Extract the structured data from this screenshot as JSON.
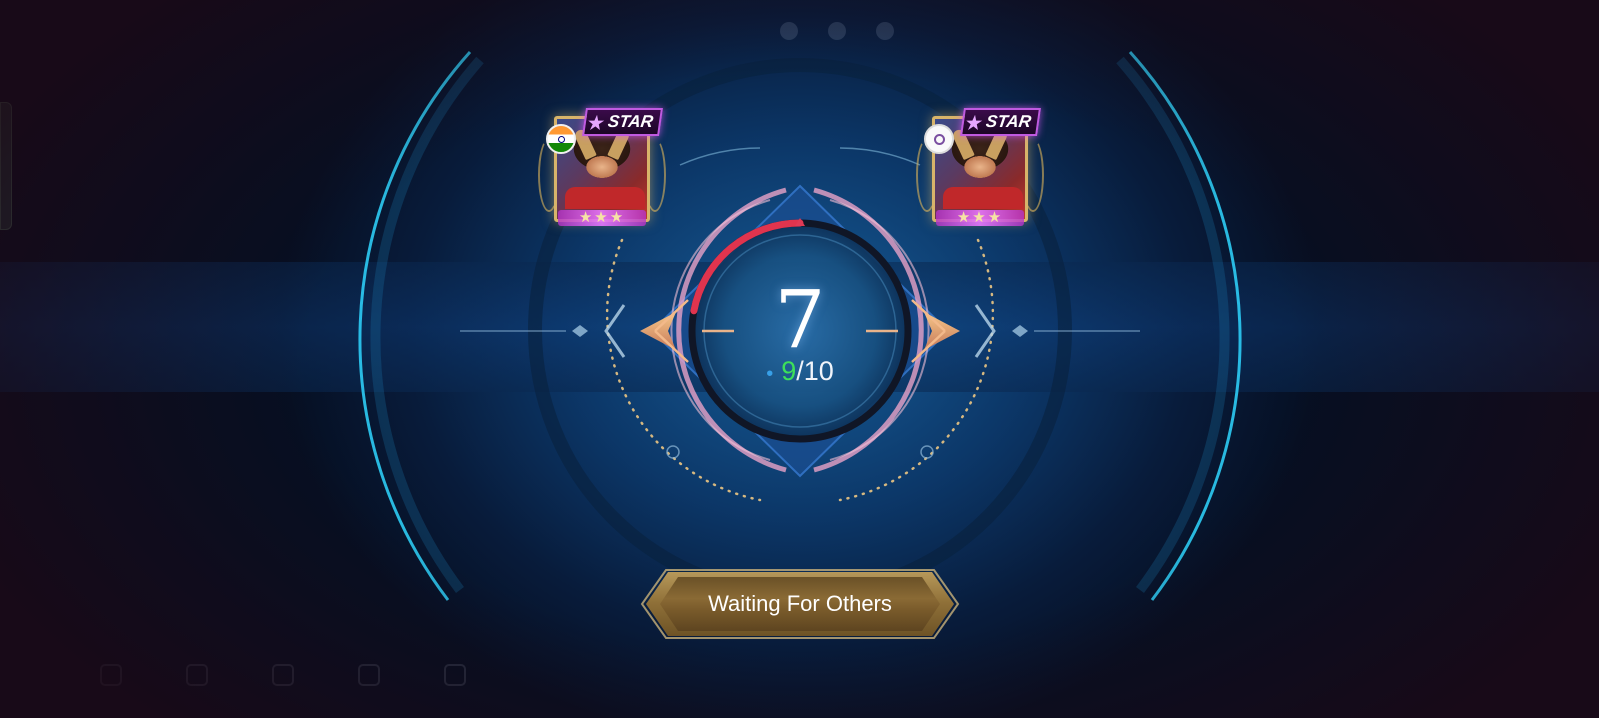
{
  "match": {
    "countdown": "7",
    "ready_count": "9",
    "ready_total": "10",
    "ready_separator": "/",
    "status_button_label": "Waiting For Others"
  },
  "players": [
    {
      "region_flag": "india-flag-icon",
      "badge_label": "STAR",
      "rank_stars": "★★★"
    },
    {
      "region_flag": "organization-emblem-icon",
      "badge_label": "STAR",
      "rank_stars": "★★★"
    }
  ],
  "colors": {
    "ready_green": "#3de05a",
    "progress_red": "#e0344e",
    "button_gold": "#8f7038",
    "ring_cyan": "#2fd6ff"
  },
  "progress": {
    "elapsed_fraction": 0.22
  }
}
